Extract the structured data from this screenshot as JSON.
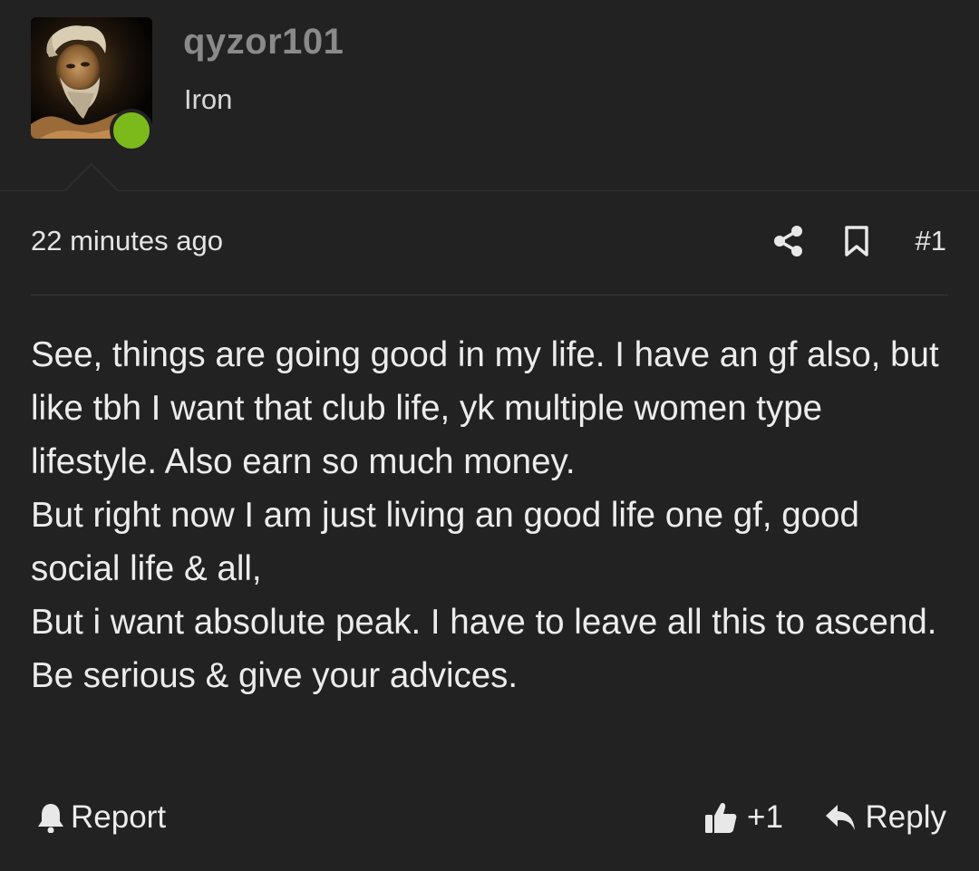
{
  "author": {
    "username": "qyzor101",
    "title": "Iron",
    "avatar": "old-bearded-man-portrait",
    "online_status": "online",
    "online_color": "#7cba1c"
  },
  "post": {
    "time": "22 minutes ago",
    "number": "#1",
    "body": [
      "See, things are going good in my life. I have an gf also, but like tbh I want that club life, yk multiple women type lifestyle. Also earn so much money.",
      "But right now I am just living an good life one gf, good social life & all,",
      "But i want absolute peak. I have to leave all this to ascend.",
      "Be serious & give your advices."
    ]
  },
  "actions": {
    "report_label": "Report",
    "like_count": "+1",
    "reply_label": "Reply"
  },
  "icons": {
    "share": "share-icon",
    "bookmark": "bookmark-icon",
    "report": "bell-icon",
    "like": "thumbs-up-icon",
    "reply": "reply-arrow-icon"
  },
  "colors": {
    "background": "#222222",
    "username": "#8a8a8a",
    "text": "#ececec"
  }
}
